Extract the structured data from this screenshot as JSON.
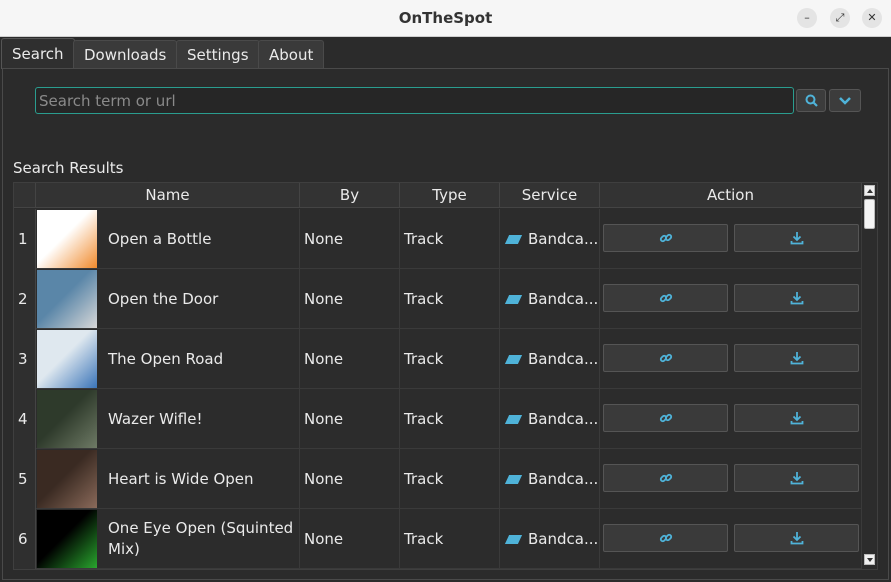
{
  "window": {
    "title": "OnTheSpot"
  },
  "tabs": [
    {
      "label": "Search"
    },
    {
      "label": "Downloads"
    },
    {
      "label": "Settings"
    },
    {
      "label": "About"
    }
  ],
  "search": {
    "placeholder": "Search term or url",
    "value": ""
  },
  "results": {
    "section_label": "Search Results",
    "columns": [
      "Name",
      "By",
      "Type",
      "Service",
      "Action"
    ],
    "rows": [
      {
        "num": "1",
        "name": "Open a Bottle",
        "by": "None",
        "type": "Track",
        "service": "Bandca...",
        "thumb_colors": [
          "#ffffff",
          "#f08a2c"
        ]
      },
      {
        "num": "2",
        "name": "Open the Door",
        "by": "None",
        "type": "Track",
        "service": "Bandca...",
        "thumb_colors": [
          "#5a86a8",
          "#d8d8d8"
        ]
      },
      {
        "num": "3",
        "name": "The Open Road",
        "by": "None",
        "type": "Track",
        "service": "Bandca...",
        "thumb_colors": [
          "#dfe8ef",
          "#3a74b8"
        ]
      },
      {
        "num": "4",
        "name": "Wazer Wifle!",
        "by": "None",
        "type": "Track",
        "service": "Bandca...",
        "thumb_colors": [
          "#2e3a2b",
          "#6e7a65"
        ]
      },
      {
        "num": "5",
        "name": "Heart is Wide Open",
        "by": "None",
        "type": "Track",
        "service": "Bandca...",
        "thumb_colors": [
          "#3a2a22",
          "#8a6a5a"
        ]
      },
      {
        "num": "6",
        "name": "One Eye Open (Squinted Mix)",
        "by": "None",
        "type": "Track",
        "service": "Bandca...",
        "thumb_colors": [
          "#000000",
          "#29a52e"
        ]
      }
    ]
  },
  "colors": {
    "accent": "#2a9d8f",
    "icon_blue": "#4fb3d9"
  },
  "icons": {
    "search": "search-icon",
    "dropdown": "chevron-down-icon",
    "link": "link-icon",
    "download": "download-icon",
    "service": "bandcamp-icon"
  }
}
